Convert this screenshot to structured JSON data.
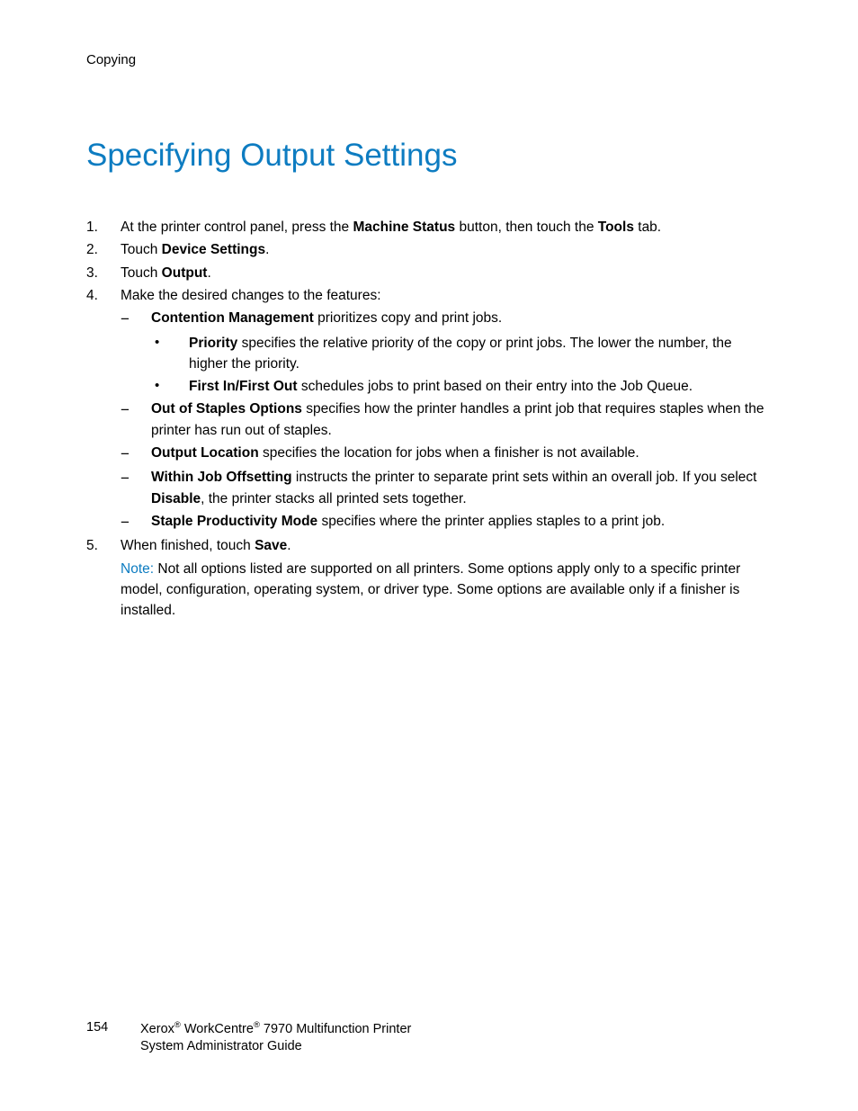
{
  "header": {
    "section": "Copying"
  },
  "title": "Specifying Output Settings",
  "steps": {
    "s1": {
      "num": "1.",
      "pre": "At the printer control panel, press the ",
      "b1": "Machine Status",
      "mid": " button, then touch the ",
      "b2": "Tools",
      "post": " tab."
    },
    "s2": {
      "num": "2.",
      "pre": "Touch ",
      "b1": "Device Settings",
      "post": "."
    },
    "s3": {
      "num": "3.",
      "pre": "Touch ",
      "b1": "Output",
      "post": "."
    },
    "s4": {
      "num": "4.",
      "text": "Make the desired changes to the features:",
      "sub": {
        "a": {
          "dash": "−",
          "b": "Contention Management",
          "post": " prioritizes copy and print jobs.",
          "bullets": {
            "i": {
              "dot": "•",
              "b": "Priority",
              "post": " specifies the relative priority of the copy or print jobs. The lower the number, the higher the priority."
            },
            "ii": {
              "dot": "•",
              "b": "First In/First Out",
              "post": " schedules jobs to print based on their entry into the Job Queue."
            }
          }
        },
        "b": {
          "dash": "−",
          "b": "Out of Staples Options",
          "post": " specifies how the printer handles a print job that requires staples when the printer has run out of staples."
        },
        "c": {
          "dash": "−",
          "b": "Output Location",
          "post": " specifies the location for jobs when a finisher is not available."
        },
        "d": {
          "dash": "−",
          "b": "Within Job Offsetting",
          "mid": " instructs the printer to separate print sets within an overall job. If you select ",
          "b2": "Disable",
          "post": ", the printer stacks all printed sets together."
        },
        "e": {
          "dash": "−",
          "b": "Staple Productivity Mode",
          "post": " specifies where the printer applies staples to a print job."
        }
      }
    },
    "s5": {
      "num": "5.",
      "pre": "When finished, touch ",
      "b1": "Save",
      "post": "."
    }
  },
  "note": {
    "label": "Note:",
    "text": " Not all options listed are supported on all printers. Some options apply only to a specific printer model, configuration, operating system, or driver type. Some options are available only if a finisher is installed."
  },
  "footer": {
    "page": "154",
    "brand1": "Xerox",
    "reg1": "®",
    "brand2": " WorkCentre",
    "reg2": "®",
    "model": " 7970 Multifunction Printer",
    "line2": "System Administrator Guide"
  }
}
